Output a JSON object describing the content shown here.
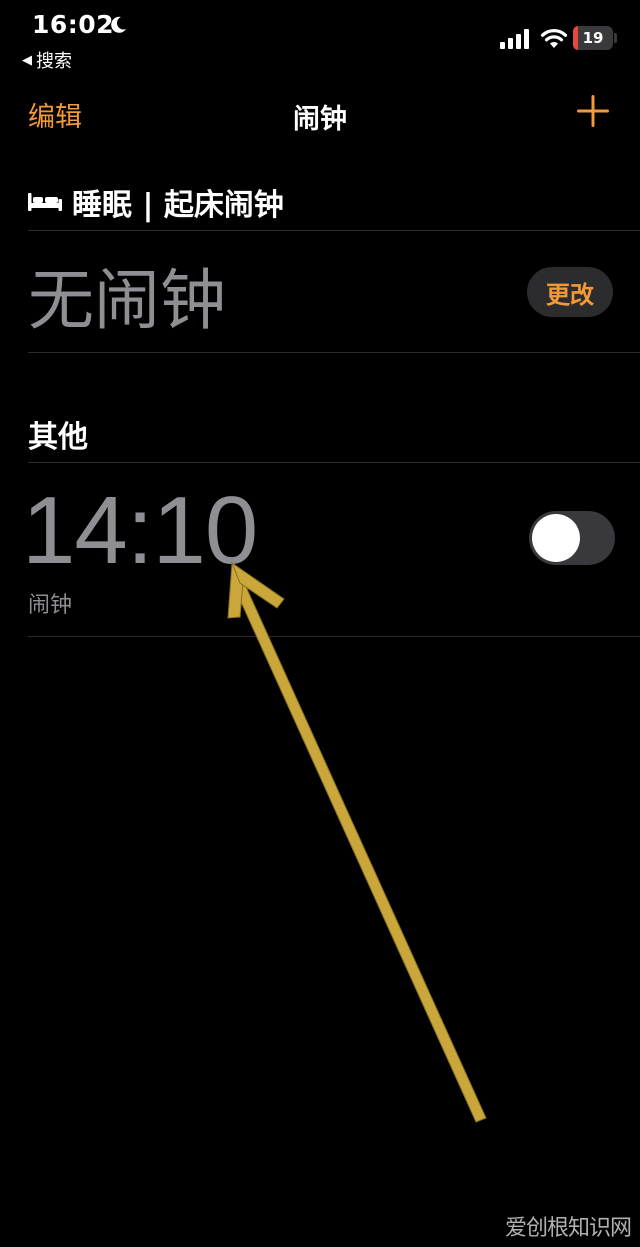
{
  "status_bar": {
    "time": "16:02",
    "back_label": "搜索",
    "battery_level": "19"
  },
  "nav": {
    "edit_label": "编辑",
    "title": "闹钟"
  },
  "sleep": {
    "header": "睡眠 | 起床闹钟",
    "no_alarm": "无闹钟",
    "change_label": "更改"
  },
  "other": {
    "header": "其他",
    "alarms": [
      {
        "time": "14:10",
        "label": "闹钟",
        "enabled": false
      }
    ]
  },
  "watermark": "爱创根知识网",
  "colors": {
    "accent": "#f19a37",
    "background": "#000000",
    "secondary_text": "#8e8e93",
    "arrow": "#c9a73a"
  }
}
